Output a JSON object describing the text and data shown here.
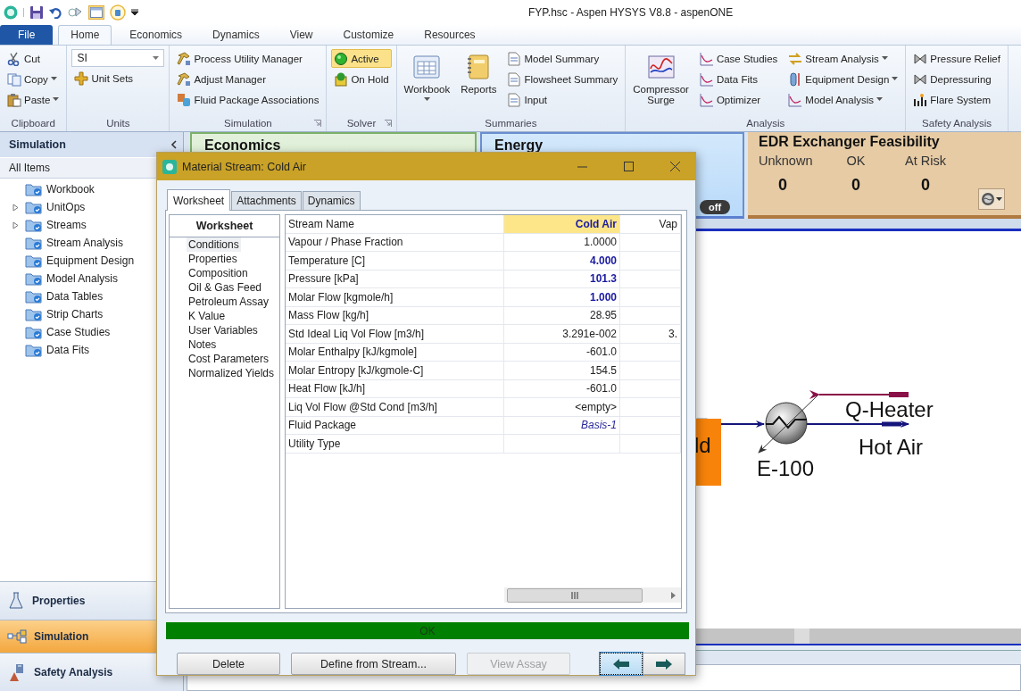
{
  "window": {
    "title": "FYP.hsc - Aspen HYSYS V8.8 - aspenONE"
  },
  "ribbon": {
    "tabs": [
      {
        "label": "File",
        "kind": "file",
        "selected": false
      },
      {
        "label": "Home",
        "kind": "tab",
        "selected": true
      },
      {
        "label": "Economics",
        "kind": "tab",
        "selected": false
      },
      {
        "label": "Dynamics",
        "kind": "tab",
        "selected": false
      },
      {
        "label": "View",
        "kind": "tab",
        "selected": false
      },
      {
        "label": "Customize",
        "kind": "tab",
        "selected": false
      },
      {
        "label": "Resources",
        "kind": "tab",
        "selected": false
      }
    ],
    "groups": [
      {
        "label": "Clipboard",
        "launcher": false,
        "items": [
          {
            "kind": "small",
            "label": "Cut",
            "dropdown": false
          },
          {
            "kind": "small",
            "label": "Copy",
            "dropdown": true
          },
          {
            "kind": "small",
            "label": "Paste",
            "dropdown": true
          }
        ]
      },
      {
        "label": "Units",
        "launcher": false,
        "items": [
          {
            "kind": "select",
            "value": "SI"
          },
          {
            "kind": "small",
            "label": "Unit Sets",
            "dropdown": false
          }
        ]
      },
      {
        "label": "Simulation",
        "launcher": true,
        "items": [
          {
            "kind": "small",
            "label": "Process Utility Manager",
            "dropdown": false
          },
          {
            "kind": "small",
            "label": "Adjust Manager",
            "dropdown": false
          },
          {
            "kind": "small",
            "label": "Fluid Package Associations",
            "dropdown": false
          }
        ]
      },
      {
        "label": "Solver",
        "launcher": true,
        "items": [
          {
            "kind": "small",
            "label": "Active",
            "dropdown": false,
            "selected": true
          },
          {
            "kind": "small",
            "label": "On Hold",
            "dropdown": false,
            "selected": false
          }
        ]
      },
      {
        "label": "Summaries",
        "launcher": false,
        "items": [
          {
            "kind": "large",
            "label": "Workbook",
            "dropdown": true
          },
          {
            "kind": "large",
            "label": "Reports",
            "dropdown": false
          },
          {
            "kind": "small",
            "label": "Model Summary",
            "dropdown": false
          },
          {
            "kind": "small",
            "label": "Flowsheet Summary",
            "dropdown": false
          },
          {
            "kind": "small",
            "label": "Input",
            "dropdown": false
          }
        ]
      },
      {
        "label": "Analysis",
        "launcher": false,
        "items": [
          {
            "kind": "large",
            "label": "Compressor Surge",
            "dropdown": false
          },
          {
            "kind": "small",
            "label": "Case Studies",
            "dropdown": false
          },
          {
            "kind": "small",
            "label": "Data Fits",
            "dropdown": false
          },
          {
            "kind": "small",
            "label": "Optimizer",
            "dropdown": false
          },
          {
            "kind": "small",
            "label": "Stream Analysis",
            "dropdown": true
          },
          {
            "kind": "small",
            "label": "Equipment Design",
            "dropdown": true
          },
          {
            "kind": "small",
            "label": "Model Analysis",
            "dropdown": true
          }
        ]
      },
      {
        "label": "Safety Analysis",
        "launcher": false,
        "items": [
          {
            "kind": "small",
            "label": "Pressure Relief",
            "dropdown": false
          },
          {
            "kind": "small",
            "label": "Depressuring",
            "dropdown": false
          },
          {
            "kind": "small",
            "label": "Flare System",
            "dropdown": false
          }
        ]
      }
    ]
  },
  "navigator": {
    "title": "Simulation",
    "filter": "All Items",
    "items": [
      {
        "label": "Workbook",
        "kind": "leaf"
      },
      {
        "label": "UnitOps",
        "kind": "branch"
      },
      {
        "label": "Streams",
        "kind": "branch"
      },
      {
        "label": "Stream Analysis",
        "kind": "leaf"
      },
      {
        "label": "Equipment Design",
        "kind": "leaf"
      },
      {
        "label": "Model Analysis",
        "kind": "leaf"
      },
      {
        "label": "Data Tables",
        "kind": "leaf"
      },
      {
        "label": "Strip Charts",
        "kind": "leaf"
      },
      {
        "label": "Case Studies",
        "kind": "leaf"
      },
      {
        "label": "Data Fits",
        "kind": "leaf"
      }
    ],
    "sections": [
      {
        "label": "Properties",
        "selected": false
      },
      {
        "label": "Simulation",
        "selected": true
      },
      {
        "label": "Safety Analysis",
        "selected": false
      }
    ]
  },
  "dashboard": {
    "economics": {
      "title": "Economics"
    },
    "energy": {
      "title": "Energy",
      "toggle": {
        "label": "off",
        "on": false
      }
    },
    "edr": {
      "title": "EDR Exchanger Feasibility",
      "counts": [
        {
          "label": "Unknown",
          "value": "0"
        },
        {
          "label": "OK",
          "value": "0"
        },
        {
          "label": "At Risk",
          "value": "0"
        }
      ]
    }
  },
  "flowsheet": {
    "feed_label": "ld",
    "unit_label": "E-100",
    "energy_label": "Q-Heater",
    "product_label": "Hot Air"
  },
  "dialog": {
    "title": "Material Stream: Cold Air",
    "tabs": [
      {
        "label": "Worksheet",
        "selected": true
      },
      {
        "label": "Attachments",
        "selected": false
      },
      {
        "label": "Dynamics",
        "selected": false
      }
    ],
    "side_title": "Worksheet",
    "side_items": [
      {
        "label": "Conditions",
        "selected": true
      },
      {
        "label": "Properties",
        "selected": false
      },
      {
        "label": "Composition",
        "selected": false
      },
      {
        "label": "Oil & Gas Feed",
        "selected": false
      },
      {
        "label": "Petroleum Assay",
        "selected": false
      },
      {
        "label": "K Value",
        "selected": false
      },
      {
        "label": "User Variables",
        "selected": false
      },
      {
        "label": "Notes",
        "selected": false
      },
      {
        "label": "Cost Parameters",
        "selected": false
      },
      {
        "label": "Normalized Yields",
        "selected": false
      }
    ],
    "table": {
      "columns": [
        "Stream Name",
        "Cold Air",
        "Vap"
      ],
      "rows": [
        {
          "label": "Vapour / Phase Fraction",
          "value": "1.0000",
          "kind": "calculated"
        },
        {
          "label": "Temperature [C]",
          "value": "4.000",
          "kind": "specified"
        },
        {
          "label": "Pressure [kPa]",
          "value": "101.3",
          "kind": "specified"
        },
        {
          "label": "Molar Flow [kgmole/h]",
          "value": "1.000",
          "kind": "specified"
        },
        {
          "label": "Mass Flow [kg/h]",
          "value": "28.95",
          "kind": "calculated"
        },
        {
          "label": "Std Ideal Liq Vol Flow [m3/h]",
          "value": "3.291e-002",
          "kind": "calculated",
          "column_3": "3."
        },
        {
          "label": "Molar Enthalpy [kJ/kgmole]",
          "value": "-601.0",
          "kind": "calculated"
        },
        {
          "label": "Molar Entropy [kJ/kgmole-C]",
          "value": "154.5",
          "kind": "calculated"
        },
        {
          "label": "Heat Flow [kJ/h]",
          "value": "-601.0",
          "kind": "calculated"
        },
        {
          "label": "Liq Vol Flow @Std Cond [m3/h]",
          "value": "<empty>",
          "kind": "calculated"
        },
        {
          "label": "Fluid Package",
          "value": "Basis-1",
          "kind": "link"
        },
        {
          "label": "Utility Type",
          "kind": "calculated"
        }
      ]
    },
    "status": {
      "text": "OK",
      "kind": "ok"
    },
    "buttons": [
      {
        "label": "Delete",
        "disabled": false
      },
      {
        "label": "Define from Stream...",
        "disabled": false
      },
      {
        "label": "View Assay",
        "disabled": true
      }
    ],
    "nav_buttons": [
      {
        "kind": "prev",
        "focused": true
      },
      {
        "kind": "next",
        "focused": false
      }
    ]
  }
}
